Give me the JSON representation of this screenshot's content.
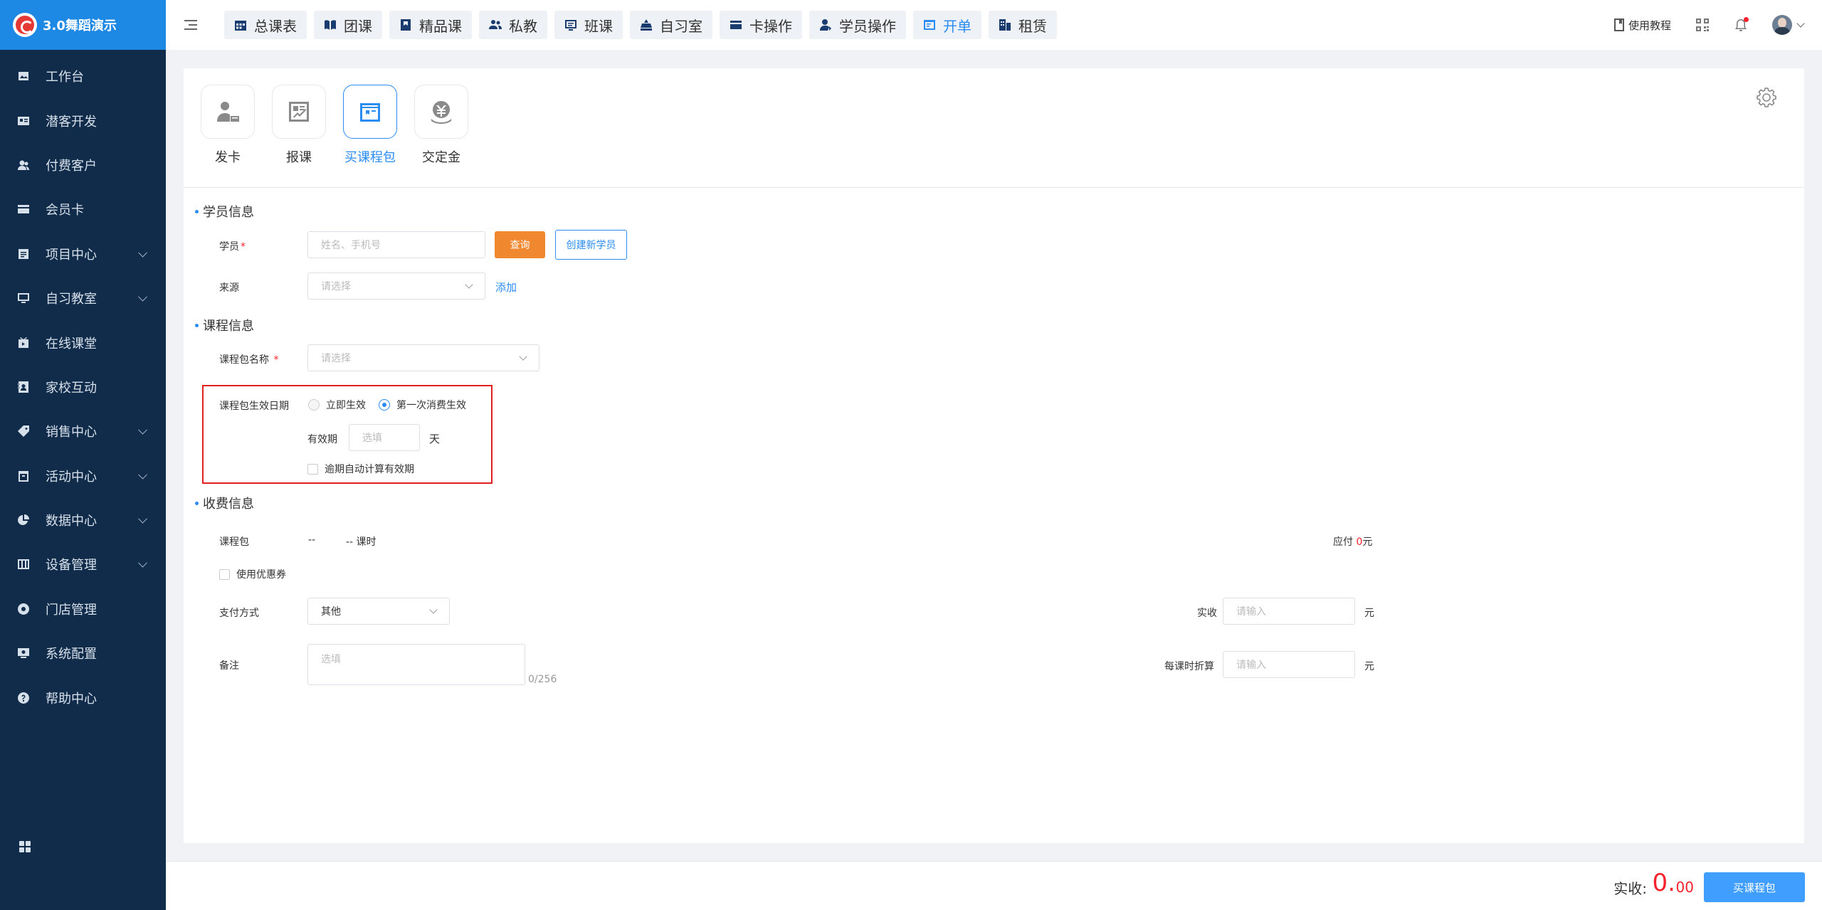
{
  "brand": {
    "title": "3.0舞蹈演示"
  },
  "sidebar": {
    "items": [
      {
        "label": "工作台",
        "icon": "image-icon",
        "expandable": false
      },
      {
        "label": "潜客开发",
        "icon": "id-card-icon",
        "expandable": false
      },
      {
        "label": "付费客户",
        "icon": "users-icon",
        "expandable": false
      },
      {
        "label": "会员卡",
        "icon": "card-icon",
        "expandable": false
      },
      {
        "label": "项目中心",
        "icon": "list-icon",
        "expandable": true
      },
      {
        "label": "自习教室",
        "icon": "monitor-icon",
        "expandable": true
      },
      {
        "label": "在线课堂",
        "icon": "tv-icon",
        "expandable": false
      },
      {
        "label": "家校互动",
        "icon": "contact-icon",
        "expandable": false
      },
      {
        "label": "销售中心",
        "icon": "tag-icon",
        "expandable": true
      },
      {
        "label": "活动中心",
        "icon": "calendar-icon",
        "expandable": true
      },
      {
        "label": "数据中心",
        "icon": "pie-chart-icon",
        "expandable": true
      },
      {
        "label": "设备管理",
        "icon": "device-icon",
        "expandable": true
      },
      {
        "label": "门店管理",
        "icon": "store-icon",
        "expandable": false
      },
      {
        "label": "系统配置",
        "icon": "system-icon",
        "expandable": false
      },
      {
        "label": "帮助中心",
        "icon": "help-icon",
        "expandable": false
      }
    ]
  },
  "topnav": {
    "tabs": [
      {
        "label": "总课表",
        "icon": "calendar-icon",
        "active": false
      },
      {
        "label": "团课",
        "icon": "book-icon",
        "active": false
      },
      {
        "label": "精品课",
        "icon": "premium-icon",
        "active": false
      },
      {
        "label": "私教",
        "icon": "coach-icon",
        "active": false
      },
      {
        "label": "班课",
        "icon": "class-icon",
        "active": false
      },
      {
        "label": "自习室",
        "icon": "study-icon",
        "active": false
      },
      {
        "label": "卡操作",
        "icon": "card-icon",
        "active": false
      },
      {
        "label": "学员操作",
        "icon": "student-icon",
        "active": false
      },
      {
        "label": "开单",
        "icon": "order-icon",
        "active": true
      },
      {
        "label": "租赁",
        "icon": "lease-icon",
        "active": false
      }
    ],
    "tutorial": "使用教程"
  },
  "operations": [
    {
      "label": "发卡",
      "icon": "issue-card-icon",
      "active": false
    },
    {
      "label": "报课",
      "icon": "enroll-icon",
      "active": false
    },
    {
      "label": "买课程包",
      "icon": "package-icon",
      "active": true
    },
    {
      "label": "交定金",
      "icon": "deposit-icon",
      "active": false
    }
  ],
  "student_section": {
    "title": "学员信息",
    "student_label": "学员",
    "student_placeholder": "姓名、手机号",
    "query_button": "查询",
    "create_button": "创建新学员",
    "source_label": "来源",
    "source_placeholder": "请选择",
    "add_link": "添加"
  },
  "course_section": {
    "title": "课程信息",
    "package_label": "课程包名称",
    "package_placeholder": "请选择",
    "effective_label": "课程包生效日期",
    "radio_immediate": "立即生效",
    "radio_first_use": "第一次消费生效",
    "selected": "first_use",
    "validity_label": "有效期",
    "validity_placeholder": "选填",
    "validity_unit": "天",
    "auto_calc_label": "逾期自动计算有效期"
  },
  "payment_section": {
    "title": "收费信息",
    "package_label": "课程包",
    "package_value": "--",
    "hours_value": "-- 课时",
    "payable_label": "应付",
    "payable_amount": "0",
    "payable_unit": "元",
    "coupon_label": "使用优惠券",
    "method_label": "支付方式",
    "method_value": "其他",
    "received_label": "实收",
    "received_placeholder": "请输入",
    "received_unit": "元",
    "remark_label": "备注",
    "remark_placeholder": "选填",
    "remark_counter": "0/256",
    "per_hour_label": "每课时折算",
    "per_hour_placeholder": "请输入",
    "per_hour_unit": "元"
  },
  "footer": {
    "total_label": "实收:",
    "total_int": "0.",
    "total_dec": "00",
    "submit_button": "买课程包"
  },
  "colors": {
    "sidebar_bg": "#112b4a",
    "brand_bg": "#1e88e5",
    "accent": "#2b8cf2",
    "query_orange": "#f0882f",
    "highlight_border": "#e02020"
  }
}
